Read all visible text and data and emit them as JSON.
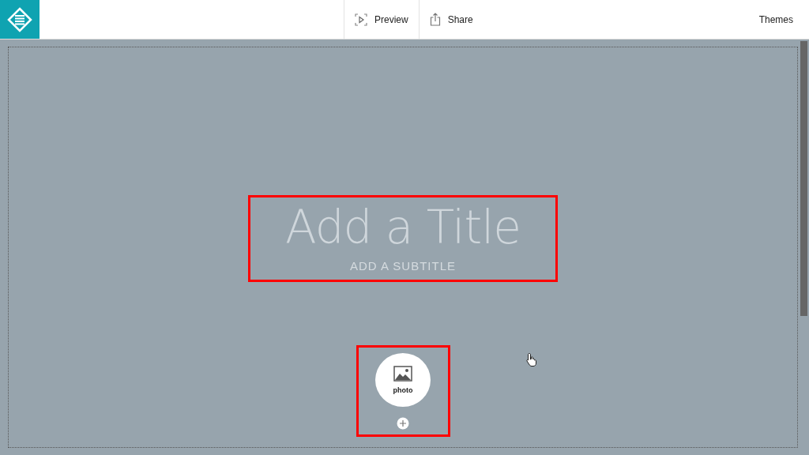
{
  "toolbar": {
    "actions": [
      {
        "label": "Preview",
        "kind": "preview"
      },
      {
        "label": "Share",
        "kind": "share"
      }
    ],
    "themes": "Themes"
  },
  "canvas": {
    "title": {
      "placeholder": "Add a Title"
    },
    "subtitle": {
      "placeholder": "ADD A SUBTITLE"
    },
    "insert": {
      "label": "photo"
    }
  }
}
